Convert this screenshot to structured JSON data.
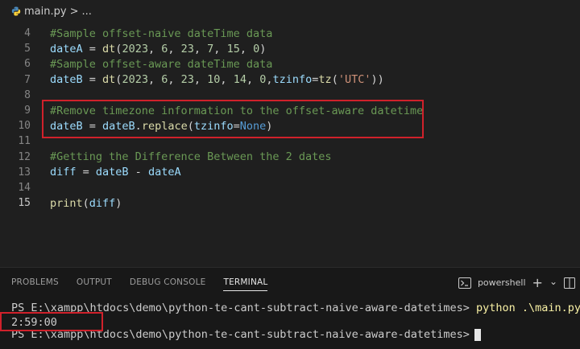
{
  "breadcrumb": {
    "file": "main.py",
    "separator": ">",
    "more": "..."
  },
  "code_lines": [
    {
      "num": "4",
      "tokens": [
        {
          "t": "#Sample offset-naive dateTime data",
          "c": "comment"
        }
      ]
    },
    {
      "num": "5",
      "tokens": [
        {
          "t": "dateA",
          "c": "var"
        },
        {
          "t": " = ",
          "c": "plain"
        },
        {
          "t": "dt",
          "c": "fn"
        },
        {
          "t": "(",
          "c": "plain"
        },
        {
          "t": "2023",
          "c": "num"
        },
        {
          "t": ", ",
          "c": "plain"
        },
        {
          "t": "6",
          "c": "num"
        },
        {
          "t": ", ",
          "c": "plain"
        },
        {
          "t": "23",
          "c": "num"
        },
        {
          "t": ", ",
          "c": "plain"
        },
        {
          "t": "7",
          "c": "num"
        },
        {
          "t": ", ",
          "c": "plain"
        },
        {
          "t": "15",
          "c": "num"
        },
        {
          "t": ", ",
          "c": "plain"
        },
        {
          "t": "0",
          "c": "num"
        },
        {
          "t": ")",
          "c": "plain"
        }
      ]
    },
    {
      "num": "6",
      "tokens": [
        {
          "t": "#Sample offset-aware dateTime data",
          "c": "comment"
        }
      ]
    },
    {
      "num": "7",
      "tokens": [
        {
          "t": "dateB",
          "c": "var"
        },
        {
          "t": " = ",
          "c": "plain"
        },
        {
          "t": "dt",
          "c": "fn"
        },
        {
          "t": "(",
          "c": "plain"
        },
        {
          "t": "2023",
          "c": "num"
        },
        {
          "t": ", ",
          "c": "plain"
        },
        {
          "t": "6",
          "c": "num"
        },
        {
          "t": ", ",
          "c": "plain"
        },
        {
          "t": "23",
          "c": "num"
        },
        {
          "t": ", ",
          "c": "plain"
        },
        {
          "t": "10",
          "c": "num"
        },
        {
          "t": ", ",
          "c": "plain"
        },
        {
          "t": "14",
          "c": "num"
        },
        {
          "t": ", ",
          "c": "plain"
        },
        {
          "t": "0",
          "c": "num"
        },
        {
          "t": ",",
          "c": "plain"
        },
        {
          "t": "tzinfo",
          "c": "var"
        },
        {
          "t": "=",
          "c": "plain"
        },
        {
          "t": "tz",
          "c": "fn"
        },
        {
          "t": "(",
          "c": "plain"
        },
        {
          "t": "'UTC'",
          "c": "str"
        },
        {
          "t": "))",
          "c": "plain"
        }
      ]
    },
    {
      "num": "8",
      "tokens": []
    },
    {
      "num": "9",
      "tokens": [
        {
          "t": "#Remove timezone information to the offset-aware datetime",
          "c": "comment"
        }
      ]
    },
    {
      "num": "10",
      "tokens": [
        {
          "t": "dateB",
          "c": "var"
        },
        {
          "t": " = ",
          "c": "plain"
        },
        {
          "t": "dateB",
          "c": "var"
        },
        {
          "t": ".",
          "c": "plain"
        },
        {
          "t": "replace",
          "c": "fn"
        },
        {
          "t": "(",
          "c": "plain"
        },
        {
          "t": "tzinfo",
          "c": "var"
        },
        {
          "t": "=",
          "c": "plain"
        },
        {
          "t": "None",
          "c": "kw"
        },
        {
          "t": ")",
          "c": "plain"
        }
      ]
    },
    {
      "num": "11",
      "tokens": []
    },
    {
      "num": "12",
      "tokens": [
        {
          "t": "#Getting the Difference Between the 2 dates",
          "c": "comment"
        }
      ]
    },
    {
      "num": "13",
      "tokens": [
        {
          "t": "diff",
          "c": "var"
        },
        {
          "t": " = ",
          "c": "plain"
        },
        {
          "t": "dateB",
          "c": "var"
        },
        {
          "t": " - ",
          "c": "plain"
        },
        {
          "t": "dateA",
          "c": "var"
        }
      ]
    },
    {
      "num": "14",
      "tokens": []
    },
    {
      "num": "15",
      "tokens": [
        {
          "t": "print",
          "c": "fn"
        },
        {
          "t": "(",
          "c": "plain"
        },
        {
          "t": "diff",
          "c": "var"
        },
        {
          "t": ")",
          "c": "plain"
        }
      ]
    }
  ],
  "active_line": "15",
  "panel": {
    "tabs": [
      "PROBLEMS",
      "OUTPUT",
      "DEBUG CONSOLE",
      "TERMINAL"
    ],
    "active_tab": "TERMINAL",
    "shell_label": "powershell",
    "add_symbol": "+",
    "dropdown_symbol": "⌄"
  },
  "terminal": {
    "prompt1": "PS E:\\xampp\\htdocs\\demo\\python-te-cant-subtract-naive-aware-datetimes>",
    "command": "python .\\main.py",
    "output": "2:59:00",
    "prompt2": "PS E:\\xampp\\htdocs\\demo\\python-te-cant-subtract-naive-aware-datetimes>"
  },
  "colors": {
    "highlight_box": "#d0212b",
    "comment": "#6a9955",
    "variable": "#9cdcfe",
    "function": "#dcdcaa",
    "number": "#b5cea8",
    "string": "#ce9178",
    "keyword": "#569cd6"
  }
}
